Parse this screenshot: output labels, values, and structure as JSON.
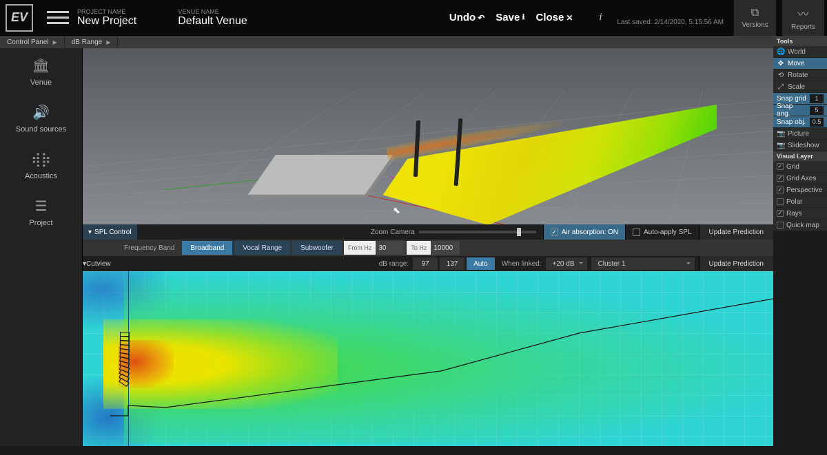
{
  "header": {
    "project_label": "PROJECT NAME",
    "project_value": "New Project",
    "venue_label": "VENUE NAME",
    "venue_value": "Default Venue",
    "undo": "Undo",
    "save": "Save",
    "close": "Close",
    "last_saved": "Last saved: 2/14/2020, 5:15:56 AM",
    "versions": "Versions",
    "reports": "Reports",
    "logo": "EV"
  },
  "breadcrumb": {
    "control_panel": "Control Panel",
    "db_range": "dB Range"
  },
  "nav": {
    "venue": "Venue",
    "sources": "Sound sources",
    "acoustics": "Acoustics",
    "project": "Project"
  },
  "tools": {
    "title": "Tools",
    "world": "World",
    "move": "Move",
    "rotate": "Rotate",
    "scale": "Scale",
    "snap_grid": "Snap grid",
    "snap_grid_v": "1",
    "snap_ang": "Snap ang.",
    "snap_ang_v": "5",
    "snap_obj": "Snap obj.",
    "snap_obj_v": "0.5",
    "picture": "Picture",
    "slideshow": "Slideshow",
    "layer_title": "Visual Layer",
    "grid": "Grid",
    "grid_axes": "Grid Axes",
    "perspective": "Perspective",
    "polar": "Polar",
    "rays": "Rays",
    "quickmap": "Quick map"
  },
  "spl": {
    "title": "SPL Control",
    "zoom": "Zoom Camera",
    "air": "Air absorption: ON",
    "auto_apply": "Auto-apply SPL",
    "update": "Update Prediction"
  },
  "freq": {
    "label": "Frequency Band",
    "broadband": "Broadband",
    "vocal": "Vocal Range",
    "sub": "Subwoofer",
    "from": "From Hz",
    "from_v": "30",
    "to": "To Hz",
    "to_v": "10000"
  },
  "cut": {
    "title": "Cutview",
    "db_range": "dB range:",
    "db_lo": "97",
    "db_hi": "137",
    "auto": "Auto",
    "when_linked": "When linked:",
    "offset": "+20 dB",
    "cluster": "Cluster 1",
    "update": "Update Prediction"
  }
}
